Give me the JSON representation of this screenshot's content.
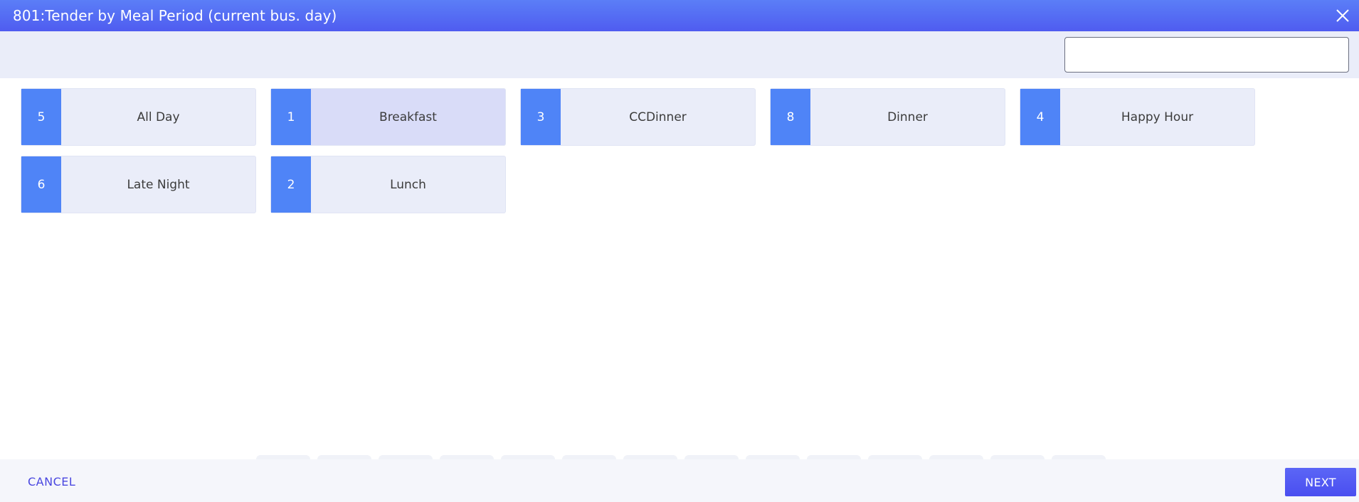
{
  "window": {
    "title": "801:Tender by Meal Period (current bus. day)",
    "close_icon": "close-icon"
  },
  "search": {
    "value": "",
    "placeholder": ""
  },
  "meal_periods": [
    {
      "number": "5",
      "label": "All Day",
      "selected": false
    },
    {
      "number": "1",
      "label": "Breakfast",
      "selected": true
    },
    {
      "number": "3",
      "label": "CCDinner",
      "selected": false
    },
    {
      "number": "8",
      "label": "Dinner",
      "selected": false
    },
    {
      "number": "4",
      "label": "Happy Hour",
      "selected": false
    },
    {
      "number": "6",
      "label": "Late Night",
      "selected": false
    },
    {
      "number": "2",
      "label": "Lunch",
      "selected": false
    }
  ],
  "footer": {
    "cancel_label": "CANCEL",
    "next_label": "NEXT"
  },
  "colors": {
    "header": "#5064f2",
    "accent": "#4f84f7",
    "tile_bg": "#eaedf9",
    "tile_selected_bg": "#d9dcf8",
    "link": "#4a47e0"
  }
}
